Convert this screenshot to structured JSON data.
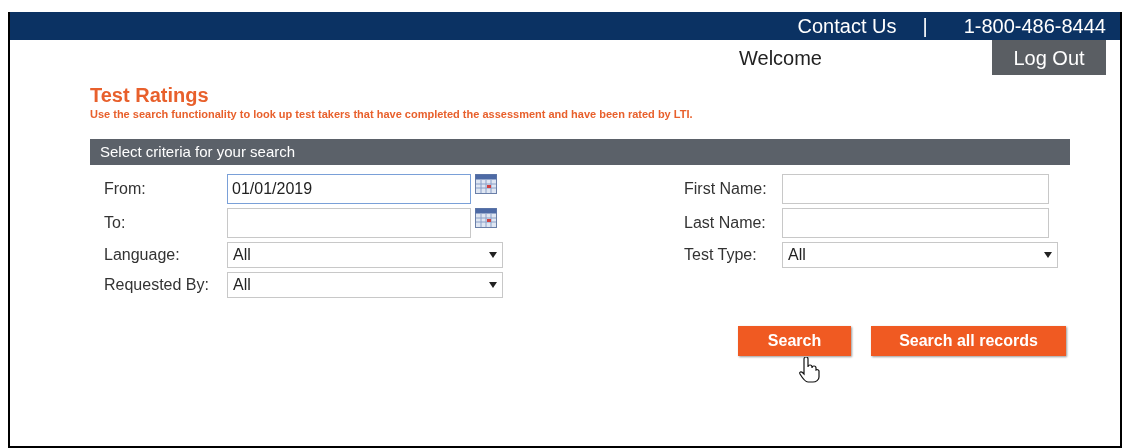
{
  "header": {
    "contact": "Contact Us",
    "separator": "|",
    "phone": "1-800-486-8444"
  },
  "user_bar": {
    "welcome": "Welcome",
    "logout": "Log Out"
  },
  "page": {
    "title": "Test Ratings",
    "description": "Use the search functionality to look up test takers that have completed the assessment and have been rated by LTI."
  },
  "criteria": {
    "heading": "Select criteria for your search",
    "left_fields": [
      {
        "kind": "date",
        "label": "From:",
        "value": "01/01/2019",
        "focused": true
      },
      {
        "kind": "date",
        "label": "To:",
        "focused": false
      },
      {
        "kind": "select",
        "label": "Language:",
        "value": "All"
      },
      {
        "kind": "select",
        "label": "Requested By:",
        "value": "All"
      }
    ],
    "right_fields": [
      {
        "kind": "text",
        "label": "First Name:"
      },
      {
        "kind": "text",
        "label": "Last Name:"
      },
      {
        "kind": "select",
        "label": "Test Type:",
        "value": "All"
      }
    ]
  },
  "buttons": [
    "Search",
    "Search all records"
  ]
}
